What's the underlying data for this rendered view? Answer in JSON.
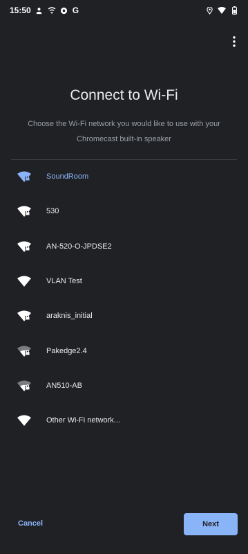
{
  "status_bar": {
    "time": "15:50",
    "left_icons": [
      "person-icon",
      "cast-icon",
      "circle-icon",
      "google-g-icon"
    ],
    "right_icons": [
      "location-icon",
      "wifi-icon",
      "battery-icon"
    ],
    "g_label": "G"
  },
  "header": {
    "title": "Connect to Wi-Fi",
    "subtitle": "Choose the Wi-Fi network you would like to use with your Chromecast built-in speaker"
  },
  "networks": [
    {
      "name": "SoundRoom",
      "secured": true,
      "selected": true
    },
    {
      "name": "530",
      "secured": true,
      "selected": false
    },
    {
      "name": "AN-520-O-JPDSE2",
      "secured": true,
      "selected": false
    },
    {
      "name": "VLAN Test",
      "secured": false,
      "selected": false
    },
    {
      "name": "araknis_initial",
      "secured": true,
      "selected": false
    },
    {
      "name": "Pakedge2.4",
      "secured": true,
      "selected": false
    },
    {
      "name": "AN510-AB",
      "secured": true,
      "selected": false
    },
    {
      "name": "Other Wi-Fi network...",
      "secured": false,
      "selected": false
    }
  ],
  "footer": {
    "cancel_label": "Cancel",
    "next_label": "Next"
  },
  "colors": {
    "background": "#202124",
    "accent": "#8ab4f8",
    "text_primary": "#e8eaed",
    "text_secondary": "#9aa0a6"
  }
}
